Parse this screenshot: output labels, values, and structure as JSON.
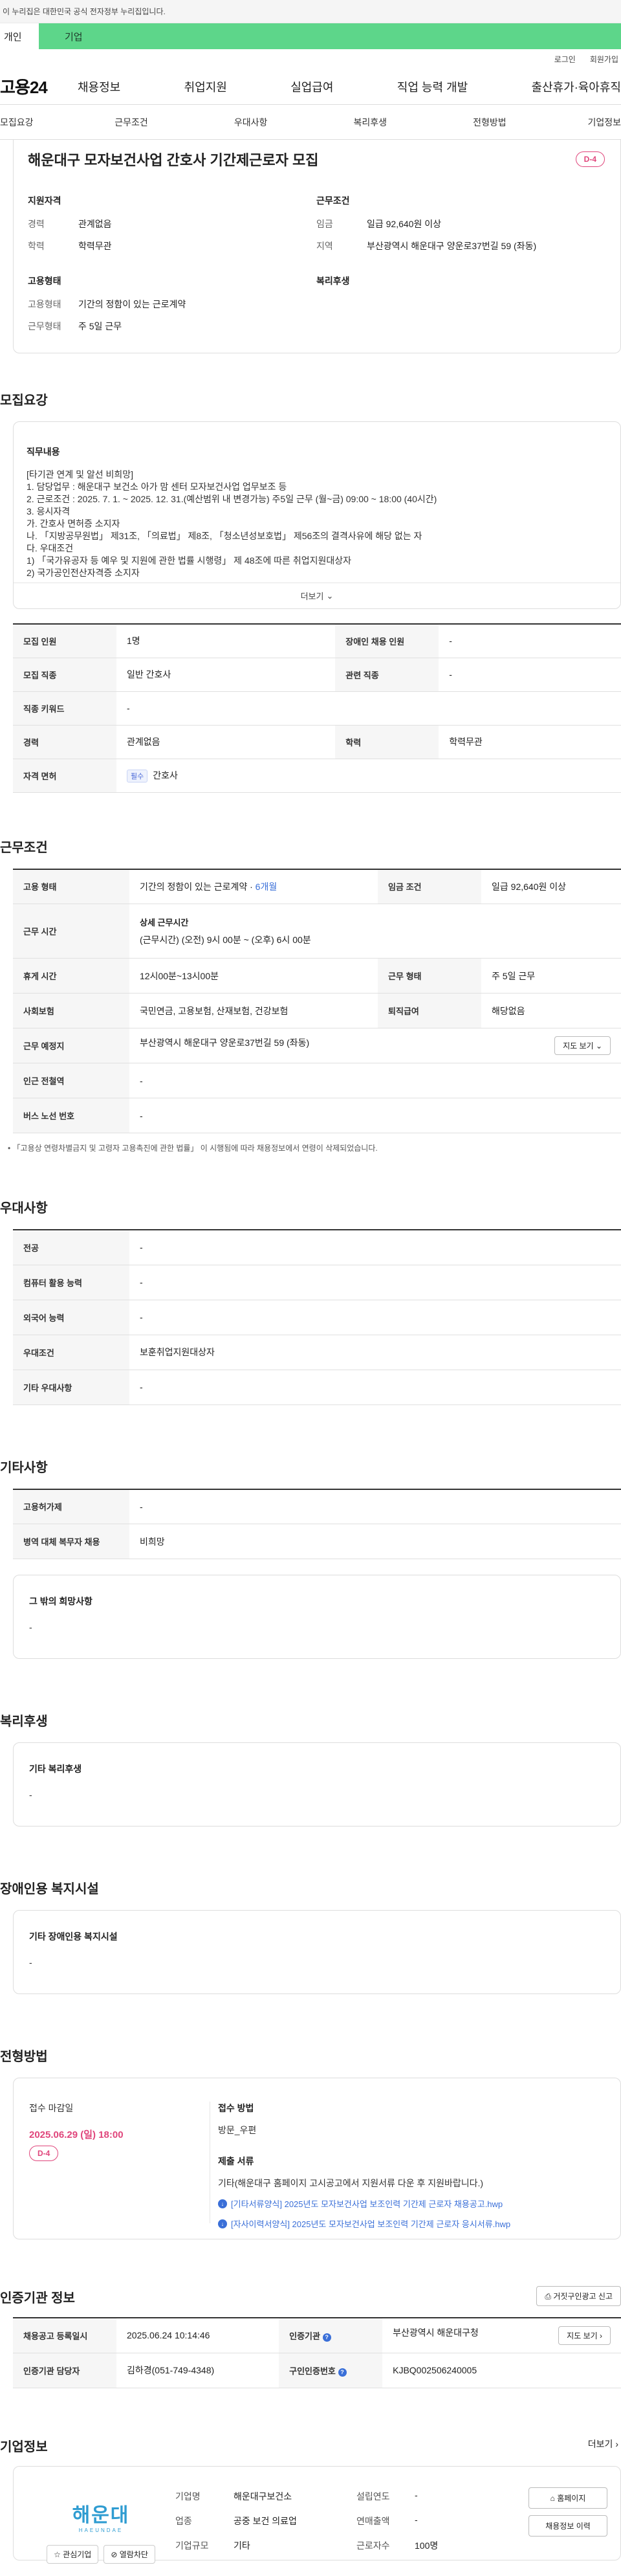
{
  "gov_bar": "이 누리집은 대한민국 공식 전자정부 누리집입니다.",
  "tabs": {
    "personal": "개인",
    "company": "기업"
  },
  "util": {
    "login": "로그인",
    "signup": "회원가입"
  },
  "gnb": {
    "logo": "고용24",
    "menu": [
      "채용정보",
      "취업지원",
      "실업급여",
      "직업 능력 개발",
      "출산휴가·육아휴직"
    ]
  },
  "subnav": [
    "모집요강",
    "근무조건",
    "우대사항",
    "복리후생",
    "전형방법",
    "기업정보"
  ],
  "job": {
    "title": "해운대구 모자보건사업 간호사 기간제근로자 모집",
    "dday": "D-4"
  },
  "summary": {
    "qual": {
      "title": "지원자격",
      "rows": [
        {
          "k": "경력",
          "v": "관계없음"
        },
        {
          "k": "학력",
          "v": "학력무관"
        }
      ]
    },
    "work": {
      "title": "근무조건",
      "rows": [
        {
          "k": "임금",
          "v": "일급 92,640원 이상"
        },
        {
          "k": "지역",
          "v": "부산광역시 해운대구 양운로37번길 59 (좌동)"
        }
      ]
    },
    "employ": {
      "title": "고용형태",
      "rows": [
        {
          "k": "고용형태",
          "v": "기간의 정함이 있는 근로계약"
        },
        {
          "k": "근무형태",
          "v": "주 5일 근무"
        }
      ]
    },
    "welfare": {
      "title": "복리후생"
    }
  },
  "recruit": {
    "title": "모집요강",
    "duty_label": "직무내용",
    "duty_text": "[타기관 연계 및 알선 비희망]\n1. 담당업무 : 해운대구 보건소 아가 맘 센터 모자보건사업 업무보조 등\n2. 근로조건 : 2025. 7. 1. ~ 2025. 12. 31.(예산범위 내 변경가능) 주5일 근무 (월~금) 09:00 ~ 18:00 (40시간)\n3. 응시자격\n   가. 간호사 면허증 소지자\n   나. 「지방공무원법」 제31조, 「의료법」 제8조, 「청소년성보호법」 제56조의 결격사유에 해당 없는 자\n   다. 우대조건\n     1) 「국가유공자 등 예우 및 지원에 관한 법률 시행령」 제 48조에 따른 취업지원대상자\n     2) 국가공인전산자격증 소지자",
    "more": "더보기",
    "table": [
      {
        "k1": "모집 인원",
        "v1": "1명",
        "k2": "장애인 채용 인원",
        "v2": "-"
      },
      {
        "k1": "모집 직종",
        "v1": "일반 간호사",
        "k2": "관련 직종",
        "v2": "-"
      },
      {
        "k1": "직종 키워드",
        "v1": "-"
      },
      {
        "k1": "경력",
        "v1": "관계없음",
        "k2": "학력",
        "v2": "학력무관"
      }
    ],
    "license_label": "자격 면허",
    "license_tag": "필수",
    "license_value": "간호사"
  },
  "work_cond": {
    "title": "근무조건",
    "employ_label": "고용 형태",
    "employ_value": "기간의 정함이 있는 근로계약 · ",
    "employ_period": "6개월",
    "wage_label": "임금 조건",
    "wage_value": "일급 92,640원 이상",
    "time_label": "근무 시간",
    "time_head": "상세 근무시간",
    "time_value": "(근무시간) (오전) 9시 00분 ~ (오후) 6시 00분",
    "break_label": "휴게 시간",
    "break_value": "12시00분~13시00분",
    "type_label": "근무 형태",
    "type_value": "주 5일 근무",
    "ins_label": "사회보험",
    "ins_value": "국민연금, 고용보험, 산재보험, 건강보험",
    "sev_label": "퇴직급여",
    "sev_value": "해당없음",
    "place_label": "근무 예정지",
    "place_value": "부산광역시 해운대구 양운로37번길 59 (좌동)",
    "map_btn": "지도 보기",
    "subway_label": "인근 전철역",
    "subway_value": "-",
    "bus_label": "버스 노선 번호",
    "bus_value": "-",
    "note": "「고용상 연령차별금지 및 고령자 고용촉진에 관한 법률」 이 시행됨에 따라 채용정보에서 연령이 삭제되었습니다."
  },
  "pref": {
    "title": "우대사항",
    "rows": [
      {
        "k": "전공",
        "v": "-"
      },
      {
        "k": "컴퓨터 활용 능력",
        "v": "-"
      },
      {
        "k": "외국어 능력",
        "v": "-"
      },
      {
        "k": "우대조건",
        "v": "보훈취업지원대상자"
      },
      {
        "k": "기타 우대사항",
        "v": "-"
      }
    ]
  },
  "etc": {
    "title": "기타사항",
    "rows": [
      {
        "k": "고용허가제",
        "v": "-"
      },
      {
        "k": "병역 대체 복무자 채용",
        "v": "비희망"
      }
    ],
    "box_label": "그 밖의 희망사항",
    "box_value": "-"
  },
  "benefit": {
    "title": "복리후생",
    "box_label": "기타 복리후생",
    "box_value": "-"
  },
  "disabled": {
    "title": "장애인용 복지시설",
    "box_label": "기타 장애인용 복지시설",
    "box_value": "-"
  },
  "process": {
    "title": "전형방법",
    "deadline_label": "접수 마감일",
    "deadline": "2025.06.29 (일) 18:00",
    "dday": "D-4",
    "method_label": "접수 방법",
    "method": "방문_우편",
    "docs_label": "제출 서류",
    "docs": "기타(해운대구 홈페이지 고시공고에서 지원서류 다운 후 지원바랍니다.)",
    "files": [
      "[기타서류양식] 2025년도 모자보건사업 보조인력 기간제 근로자 채용공고.hwp",
      "[자사이력서양식] 2025년도 모자보건사업 보조인력 기간제 근로자 응시서류.hwp"
    ]
  },
  "cert": {
    "title": "인증기관 정보",
    "report_btn": "거짓구인광고 신고",
    "rows": [
      {
        "k1": "채용공고 등록일시",
        "v1": "2025.06.24 10:14:46",
        "k2": "인증기관",
        "v2": "부산광역시 해운대구청",
        "btn": "지도 보기"
      },
      {
        "k1": "인증기관 담당자",
        "v1": "김하경(051-749-4348)",
        "k2": "구인인증번호",
        "v2": "KJBQ002506240005"
      }
    ]
  },
  "company": {
    "title": "기업정보",
    "more": "더보기",
    "logo_text": "해운대",
    "logo_sub": "HAEUNDAE",
    "interest_btn": "관심기업",
    "block_btn": "열람차단",
    "info": [
      {
        "k": "기업명",
        "v": "해운대구보건소",
        "k2": "설립연도",
        "v2": "-"
      },
      {
        "k": "업종",
        "v": "공중 보건 의료업",
        "k2": "연매출액",
        "v2": "-"
      },
      {
        "k": "기업규모",
        "v": "기타",
        "k2": "근로자수",
        "v2": "100명"
      }
    ],
    "homepage_btn": "홈페이지",
    "history_btn": "채용정보 이력"
  }
}
